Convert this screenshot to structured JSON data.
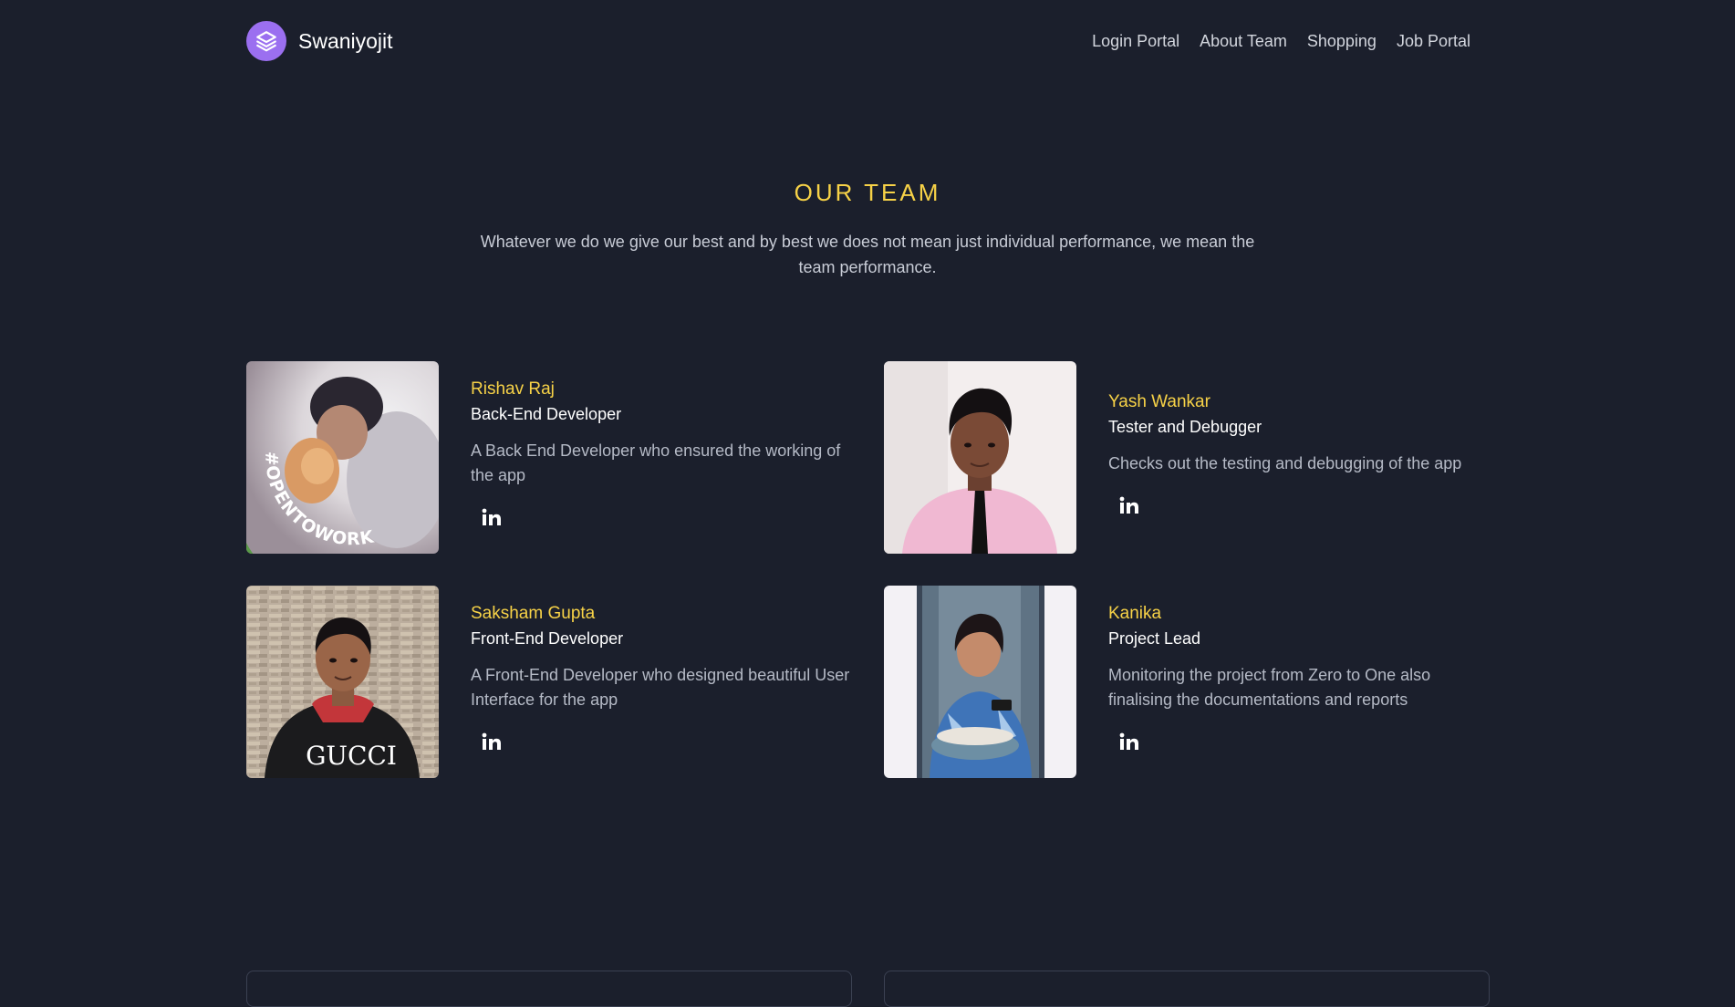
{
  "brand": {
    "name": "Swaniyojit",
    "logo_icon": "layers-icon",
    "logo_color": "#9b6ff0"
  },
  "nav": {
    "items": [
      {
        "label": "Login Portal"
      },
      {
        "label": "About Team"
      },
      {
        "label": "Shopping"
      },
      {
        "label": "Job Portal"
      }
    ]
  },
  "team": {
    "title": "OUR TEAM",
    "description": "Whatever we do we give our best and by best we does not mean just individual performance, we mean the team performance.",
    "members": [
      {
        "name": "Rishav Raj",
        "role": "Back-End Developer",
        "description": "A Back End Developer who ensured the working of the app",
        "social_icon": "linkedin-icon",
        "photo_badge": "#OPENTOWORK"
      },
      {
        "name": "Yash Wankar",
        "role": "Tester and Debugger",
        "description": "Checks out the testing and debugging of the app",
        "social_icon": "linkedin-icon"
      },
      {
        "name": "Saksham Gupta",
        "role": "Front-End Developer",
        "description": "A Front-End Developer who designed beautiful User Interface for the app",
        "social_icon": "linkedin-icon",
        "photo_text": "GUCCI"
      },
      {
        "name": "Kanika",
        "role": "Project Lead",
        "description": "Monitoring the project from Zero to One also finalising the documentations and reports",
        "social_icon": "linkedin-icon"
      }
    ]
  },
  "colors": {
    "background": "#1b1f2c",
    "accent": "#f7d247",
    "text": "#ffffff",
    "muted": "#b5bac6"
  }
}
